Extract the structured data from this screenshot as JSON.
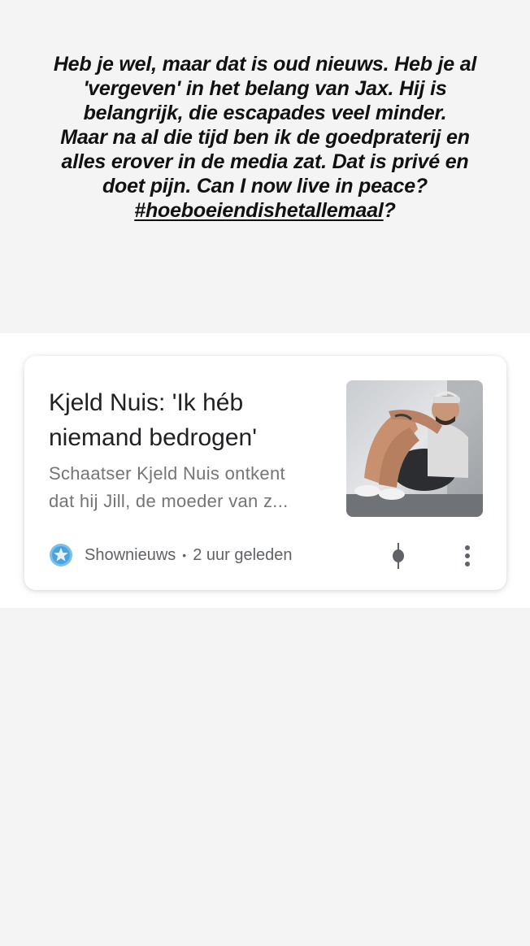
{
  "story": {
    "caption_lines": [
      "Heb je wel, maar dat is oud nieuws. Heb je al",
      "'vergeven' in het belang van Jax. Hij is",
      "belangrijk, die escapades veel minder.",
      "Maar na al die tijd ben ik de goedpraterij en",
      "alles erover in de media zat. Dat is privé en",
      "doet pijn. Can I now live in peace?"
    ],
    "hashtag": "#hoeboeiendishetallemaal",
    "hashtag_suffix": "?"
  },
  "news_card": {
    "headline_line1": "Kjeld Nuis: 'Ik héb",
    "headline_line2": "niemand bedrogen'",
    "snippet_line1": "Schaatser Kjeld Nuis ontkent",
    "snippet_line2": "dat hij Jill, de moeder van z...",
    "source": "Shownieuws",
    "separator": "•",
    "time": "2 uur geleden",
    "source_icon": "star-badge-icon",
    "icons": {
      "thumbnail": "news-thumbnail-photo",
      "pin": "pin-icon",
      "more": "more-vert-icon"
    },
    "colors": {
      "source_icon_bg": "#4aa3df",
      "text_primary": "#202124",
      "text_secondary": "#757575"
    }
  }
}
